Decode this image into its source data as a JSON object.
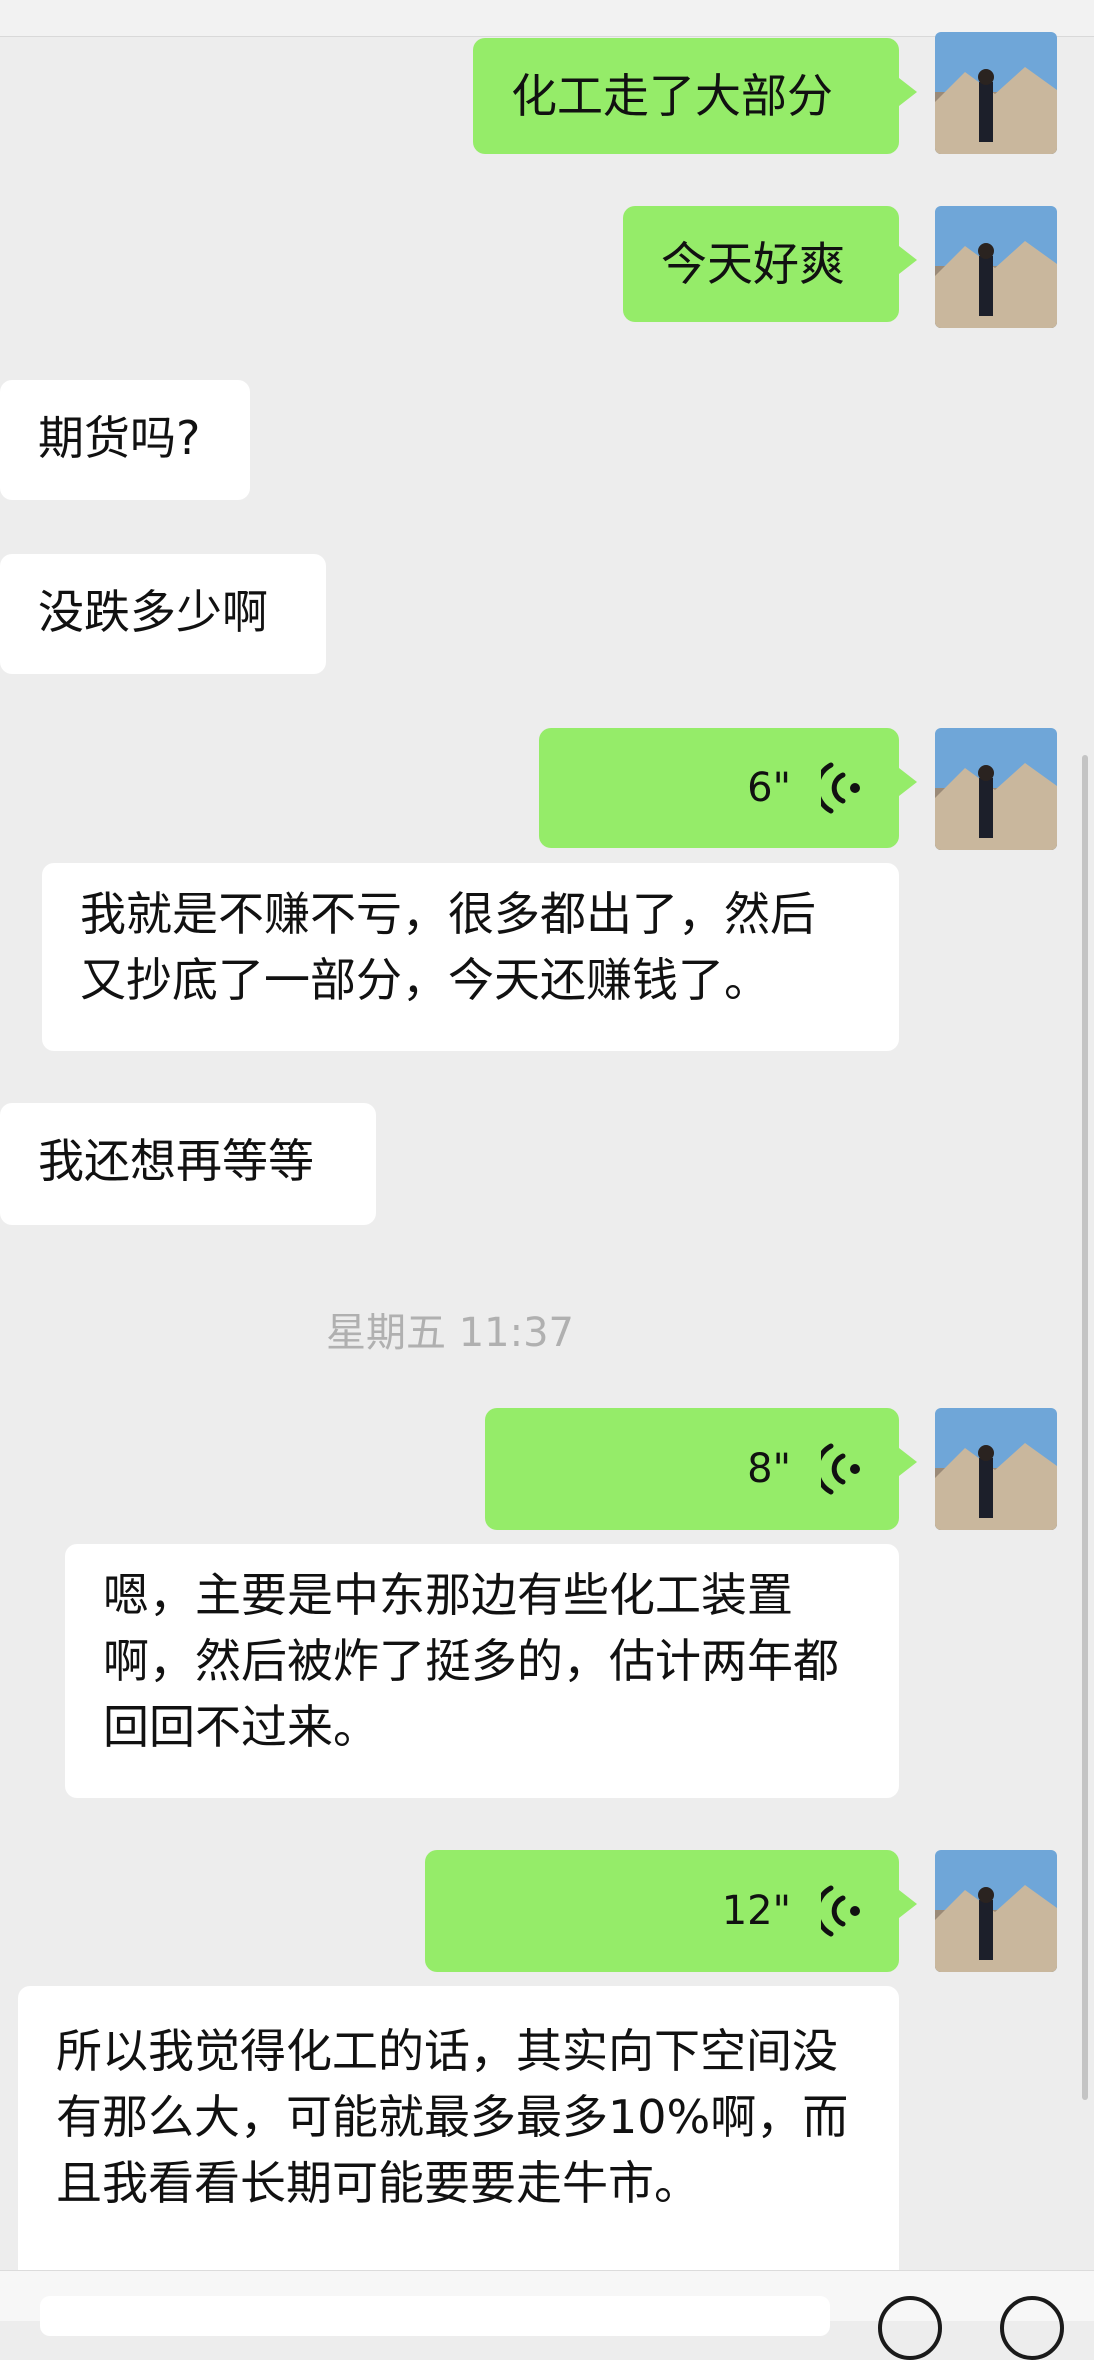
{
  "messages": [
    {
      "type": "text",
      "side": "sent",
      "text": "化工走了大部分"
    },
    {
      "type": "text",
      "side": "sent",
      "text": "今天好爽"
    },
    {
      "type": "text",
      "side": "received",
      "text": "期货吗?"
    },
    {
      "type": "text",
      "side": "received",
      "text": "没跌多少啊"
    },
    {
      "type": "voice",
      "side": "sent",
      "duration": "6\"",
      "transcript": "我就是不赚不亏，很多都出了，然后又抄底了一部分，今天还赚钱了。"
    },
    {
      "type": "text",
      "side": "received",
      "text": "我还想再等等"
    },
    {
      "type": "timestamp",
      "text": "星期五 11:37"
    },
    {
      "type": "voice",
      "side": "sent",
      "duration": "8\"",
      "transcript": "嗯，主要是中东那边有些化工装置啊，然后被炸了挺多的，估计两年都回回不过来。"
    },
    {
      "type": "voice",
      "side": "sent",
      "duration": "12\"",
      "transcript": "所以我觉得化工的话，其实向下空间没有那么大，可能就最多最多10%啊，而且我看看长期可能要要走牛市。"
    }
  ],
  "colors": {
    "background": "#ededed",
    "sent_bubble": "#95ec69",
    "received_bubble": "#ffffff",
    "timestamp": "#b0b0b0"
  }
}
